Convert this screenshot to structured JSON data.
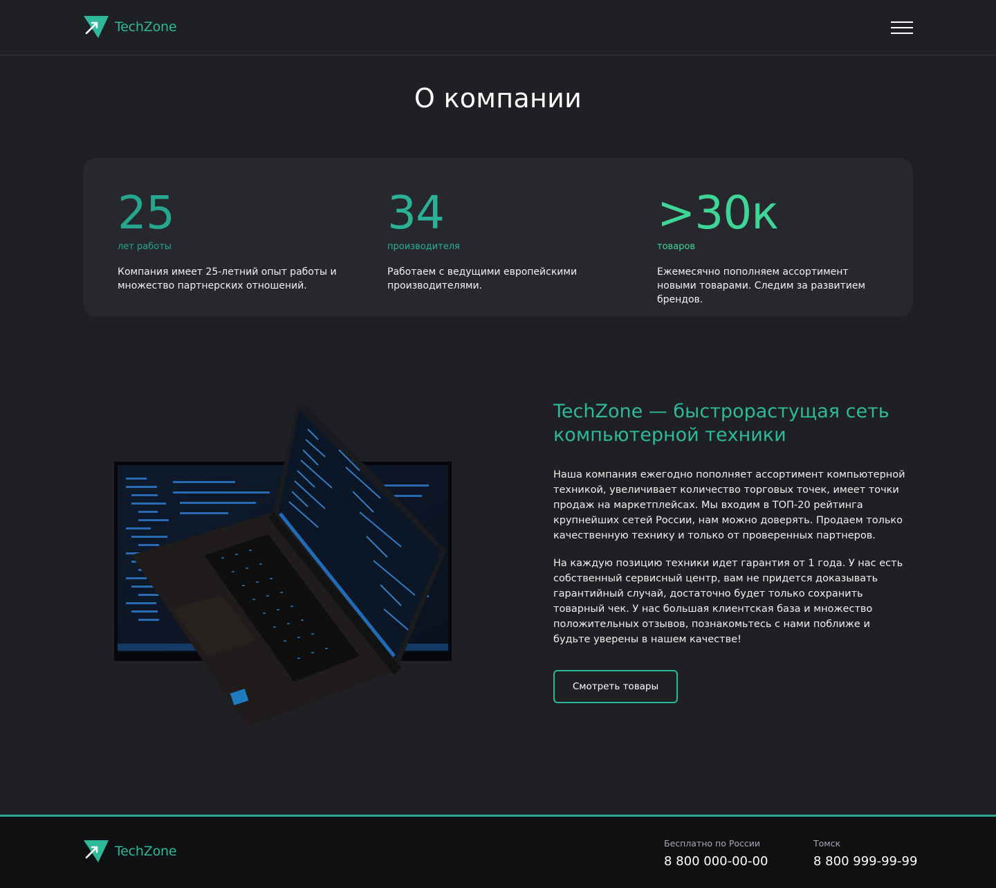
{
  "brand": {
    "name": "TechZone",
    "accent": "#2db99a"
  },
  "header": {
    "menu_icon": "hamburger-menu-icon"
  },
  "page": {
    "title": "О компании"
  },
  "stats": [
    {
      "number": "25",
      "unit": "лет работы",
      "text": "Компания имеет 25-летний опыт работы и множество партнерских отношений.",
      "color": "#26a58f"
    },
    {
      "number": "34",
      "unit": "производителя",
      "text": "Работаем с ведущими европейскими производителями.",
      "color": "#2bb196"
    },
    {
      "number": ">30к",
      "unit": "товаров",
      "text": "Ежемесячно пополняем ассортимент новыми товарами. Следим за развитием брендов.",
      "color": "#3fd597"
    }
  ],
  "about": {
    "heading": "TechZone — быстрорастущая сеть компьютерной техники",
    "paragraph1": "Наша компания ежегодно пополняет ассортимент компьютерной техникой, увеличивает количество торговых точек, имеет точки продаж на маркетплейсах. Мы входим в ТОП-20 рейтинга крупнейших сетей России, нам можно доверять. Продаем только качественную технику и только от проверенных партнеров.",
    "paragraph2": "На каждую позицию техники идет гарантия от 1 года. У нас есть собственный сервисный центр, вам не придется доказывать гарантийный случай, достаточно будет только сохранить товарный чек. У нас большая клиентская база и множество положительных отзывов, познакомьтесь с нами поближе и будьте уверены в нашем качестве!",
    "button": "Смотреть товары"
  },
  "footer": {
    "contacts": [
      {
        "label": "Бесплатно по России",
        "phone": "8 800 000-00-00"
      },
      {
        "label": "Томск",
        "phone": "8 800 999-99-99"
      }
    ]
  }
}
